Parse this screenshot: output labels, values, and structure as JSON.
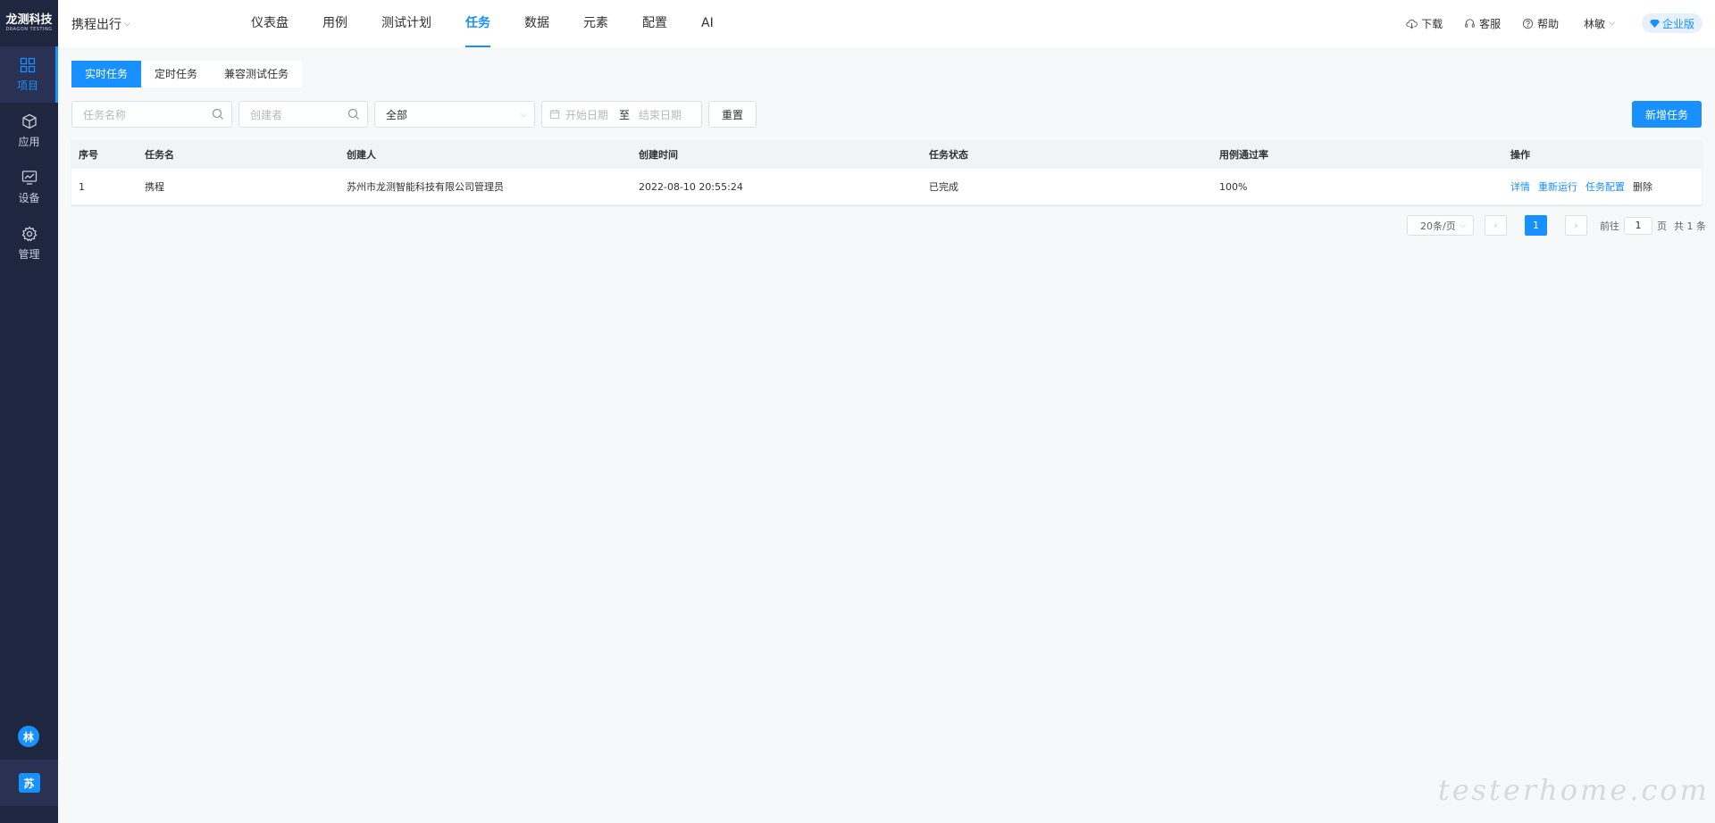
{
  "sidebar": {
    "logo_cn": "龙测科技",
    "logo_en": "DRAGON TESTING",
    "items": [
      {
        "label": "项目",
        "icon": "grid-icon"
      },
      {
        "label": "应用",
        "icon": "cube-icon"
      },
      {
        "label": "设备",
        "icon": "monitor-chart-icon"
      },
      {
        "label": "管理",
        "icon": "gear-icon"
      }
    ],
    "user_initial": "林",
    "org_initial": "苏"
  },
  "header": {
    "project": "携程出行",
    "nav": [
      "仪表盘",
      "用例",
      "测试计划",
      "任务",
      "数据",
      "元素",
      "配置",
      "AI"
    ],
    "active_nav": "任务",
    "download": "下载",
    "service": "客服",
    "help": "帮助",
    "user": "林敏",
    "edition": "企业版"
  },
  "tabs": [
    "实时任务",
    "定时任务",
    "兼容测试任务"
  ],
  "filters": {
    "task_name_placeholder": "任务名称",
    "creator_placeholder": "创建者",
    "status_value": "全部",
    "start_placeholder": "开始日期",
    "to": "至",
    "end_placeholder": "结束日期",
    "reset": "重置"
  },
  "add_button": "新增任务",
  "table": {
    "headers": [
      "序号",
      "任务名",
      "创建人",
      "创建时间",
      "任务状态",
      "用例通过率",
      "操作"
    ],
    "rows": [
      {
        "index": "1",
        "name": "携程",
        "creator": "苏州市龙测智能科技有限公司管理员",
        "created": "2022-08-10 20:55:24",
        "status": "已完成",
        "pass_rate": "100%"
      }
    ],
    "actions": [
      "详情",
      "重新运行",
      "任务配置",
      "删除"
    ]
  },
  "pagination": {
    "page_size": "20条/页",
    "current": "1",
    "goto_prefix": "前往",
    "goto_value": "1",
    "goto_suffix": "页",
    "total": "共 1 条"
  },
  "watermark": "testerhome.com",
  "colors": {
    "primary": "#1890ff",
    "sidebar_bg": "#1f2640"
  }
}
